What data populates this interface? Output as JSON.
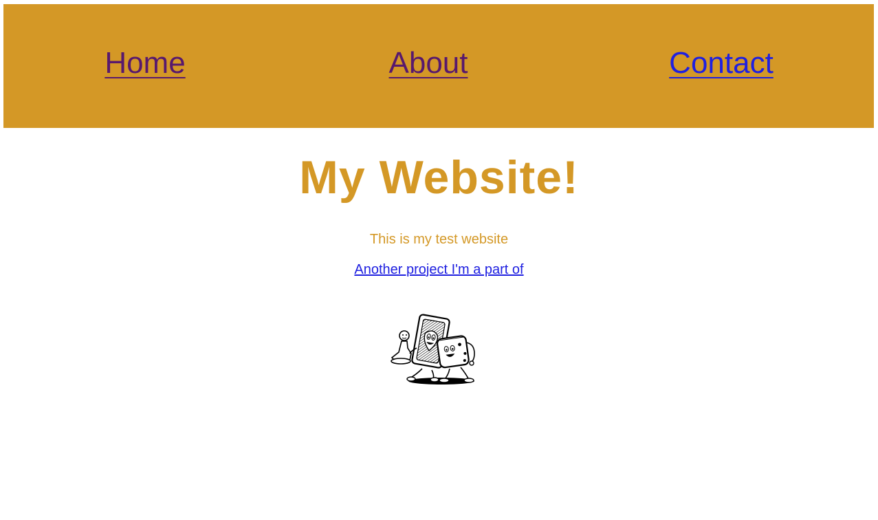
{
  "nav": {
    "home_label": "Home",
    "about_label": "About",
    "contact_label": "Contact"
  },
  "main": {
    "title": "My Website!",
    "subtitle": "This is my test website",
    "project_link_label": "Another project I'm a part of"
  },
  "colors": {
    "accent": "#d49826",
    "link": "#1f20e0",
    "visited_link": "#58196d",
    "background": "#ffffff"
  },
  "icons": {
    "mascot": "card-and-dice-mascot-icon"
  }
}
